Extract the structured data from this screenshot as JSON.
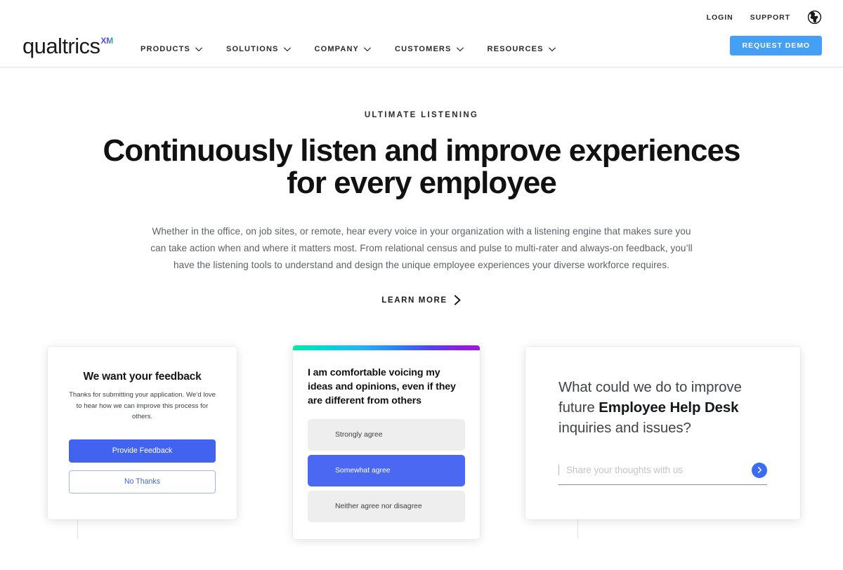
{
  "header": {
    "brand": {
      "word": "qualtrics",
      "superscript": "XM",
      "period": "."
    },
    "utility_links": [
      {
        "label": "LOGIN"
      },
      {
        "label": "SUPPORT"
      }
    ],
    "locale_icon": "globe-icon",
    "nav_items": [
      {
        "label": "PRODUCTS"
      },
      {
        "label": "SOLUTIONS"
      },
      {
        "label": "COMPANY"
      },
      {
        "label": "CUSTOMERS"
      },
      {
        "label": "RESOURCES"
      }
    ],
    "cta": {
      "label": "REQUEST DEMO",
      "color": "#43a0f5"
    }
  },
  "hero": {
    "eyebrow": "ULTIMATE LISTENING",
    "title": "Continuously listen and improve experiences for every employee",
    "body": "Whether in the office, on job sites, or remote, hear every voice in your organization with a listening engine that makes sure you can take action when and where it matters most. From relational census and pulse to multi-rater and always-on feedback, you’ll have the listening tools to understand and design the unique employee experiences your diverse workforce requires.",
    "cta_label": "LEARN MORE"
  },
  "cards": {
    "feedback": {
      "title": "We want your feedback",
      "body": "Thanks for submitting your application. We’d love to hear how we can improve this process for others.",
      "primary_label": "Provide Feedback",
      "secondary_label": "No Thanks",
      "primary_color": "#4263f0"
    },
    "survey": {
      "question": "I am comfortable voicing my ideas and opinions, even if they are different from others",
      "options": [
        {
          "label": "Strongly agree",
          "selected": false
        },
        {
          "label": "Somewhat agree",
          "selected": true
        },
        {
          "label": "Neither agree nor disagree",
          "selected": false
        }
      ],
      "selected_color": "#4a68f2",
      "gradient": "teal-to-purple"
    },
    "open_text": {
      "question_prefix": "What could we do to improve future ",
      "question_bold": "Employee Help Desk",
      "question_suffix": " inquiries and issues?",
      "placeholder": "Share your thoughts with us",
      "value": "",
      "submit_icon": "chevron-right-icon",
      "submit_color": "#3b6df0"
    }
  }
}
